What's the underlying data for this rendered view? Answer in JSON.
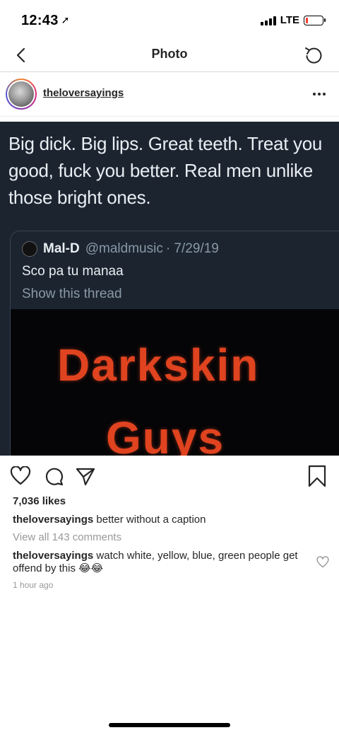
{
  "status_bar": {
    "time": "12:43",
    "location_glyph": "➚",
    "network": "LTE",
    "battery_level": 0.12,
    "battery_color": "#ff3b30"
  },
  "nav": {
    "back_icon": "chevron-left-icon",
    "title": "Photo",
    "refresh_icon": "refresh-icon"
  },
  "post": {
    "username": "theloversayings",
    "image": {
      "tweet_text": "Big dick. Big lips. Great teeth. Treat you good, fuck you better. Real men unlike those bright ones.",
      "quote": {
        "name": "Mal-D",
        "handle": "@maldmusic",
        "date": "· 7/29/19",
        "text": "Sco pa tu manaa",
        "thread_link": "Show this thread",
        "media_line1": "Darkskin",
        "media_line2": "Guys"
      }
    },
    "likes": "7,036 likes",
    "caption": {
      "user": "theloversayings",
      "text": "better without a caption"
    },
    "view_comments": "View all 143 comments",
    "comment": {
      "user": "theloversayings",
      "text": "watch white, yellow, blue, green people get offend by this 😂😂"
    },
    "time_ago": "1 hour ago"
  },
  "colors": {
    "accent_text": "#262626",
    "muted_text": "#999999",
    "image_bg": "#1c2430",
    "media_text": "#e0431f"
  }
}
